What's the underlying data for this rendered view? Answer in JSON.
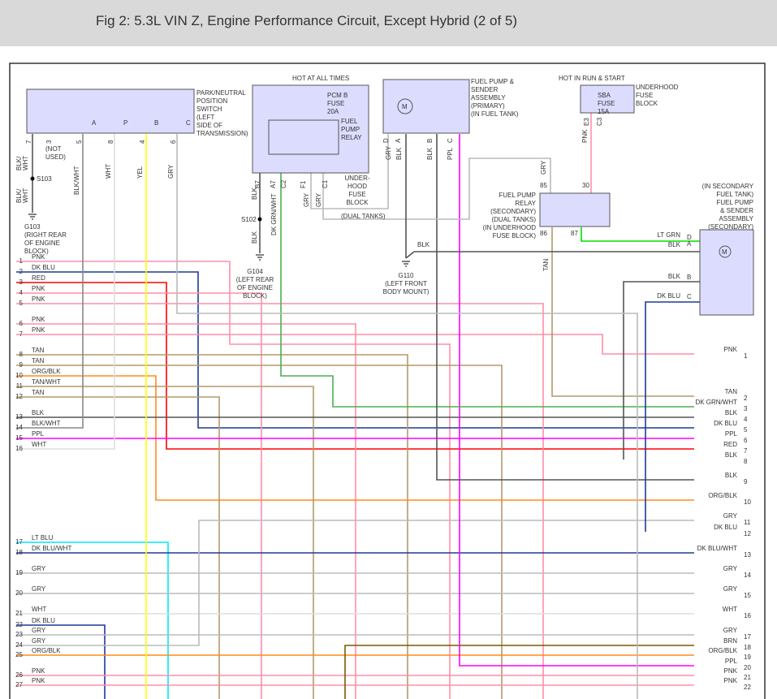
{
  "title": "Fig 2: 5.3L VIN Z, Engine Performance Circuit, Except Hybrid (2 of 5)",
  "components": {
    "pnp_switch": [
      "PARK/NEUTRAL",
      "POSITION",
      "SWITCH",
      "(LEFT",
      "SIDE OF",
      "TRANSMISSION)"
    ],
    "pnp_contacts": [
      "A",
      "P",
      "B",
      "C"
    ],
    "pnp_pins": [
      "7",
      "3",
      "5",
      "8",
      "4",
      "6"
    ],
    "not_used": [
      "(NOT",
      "USED)"
    ],
    "hot_all_times": "HOT AT ALL TIMES",
    "pcm_fuse": [
      "PCM B",
      "FUSE",
      "20A"
    ],
    "fuel_pump_relay": [
      "FUEL",
      "PUMP",
      "RELAY"
    ],
    "underhood_fuse_block_1": [
      "UNDER-",
      "HOOD",
      "FUSE",
      "BLOCK"
    ],
    "fuse_block_pins": [
      "B7",
      "A7",
      "C2",
      "F1",
      "C1"
    ],
    "fuel_pump_primary": [
      "FUEL PUMP &",
      "SENDER",
      "ASSEMBLY",
      "(PRIMARY)",
      "(IN FUEL TANK)"
    ],
    "pump_pins": [
      "D",
      "A",
      "B",
      "C"
    ],
    "hot_run_start": "HOT IN RUN & START",
    "sba_fuse": [
      "SBA",
      "FUSE",
      "15A"
    ],
    "underhood_fuse_block_2": [
      "UNDERHOOD",
      "FUSE",
      "BLOCK"
    ],
    "sba_pins": [
      "E3",
      "C3"
    ],
    "relay_secondary": [
      "FUEL PUMP",
      "RELAY",
      "(SECONDARY)",
      "(DUAL TANKS)",
      "(IN UNDERHOOD",
      "FUSE BLOCK)"
    ],
    "relay_pins": [
      "85",
      "30",
      "86",
      "87"
    ],
    "pump_secondary": [
      "(IN SECONDARY",
      "FUEL TANK)",
      "FUEL PUMP",
      "& SENDER",
      "ASSEMBLY",
      "(SECONDARY)"
    ],
    "secondary_pins": [
      "D",
      "A",
      "B",
      "C"
    ],
    "motor": "M",
    "dual_tanks": "(DUAL TANKS)",
    "splices": [
      "S103",
      "S102"
    ],
    "g103": [
      "G103",
      "(RIGHT REAR",
      "OF ENGINE",
      "BLOCK)"
    ],
    "g104": [
      "G104",
      "(LEFT REAR",
      "OF ENGINE",
      "BLOCK)"
    ],
    "g110": [
      "G110",
      "(LEFT FRONT",
      "BODY MOUNT)"
    ]
  },
  "wire_labels": {
    "pnp": [
      "BLK/",
      "WHT",
      "BLK/",
      "WHT",
      "BLK/WHT",
      "WHT",
      "YEL",
      "GRY"
    ],
    "fuse": [
      "BLK",
      "DK GRN/WHT",
      "GRY",
      "GRY",
      "BLK"
    ],
    "pump": [
      "GRY",
      "BLK",
      "BLK",
      "PPL"
    ],
    "sba": "PNK",
    "relay_gry": "GRY",
    "relay_tan": "TAN",
    "g110_blk": "BLK",
    "secondary": [
      "LT GRN",
      "BLK",
      "BLK",
      "DK BLU"
    ]
  },
  "left_connector": [
    {
      "pin": "1",
      "label": "PNK"
    },
    {
      "pin": "2",
      "label": "DK BLU"
    },
    {
      "pin": "3",
      "label": "RED"
    },
    {
      "pin": "4",
      "label": "PNK"
    },
    {
      "pin": "5",
      "label": "PNK"
    },
    {
      "pin": "6",
      "label": "PNK"
    },
    {
      "pin": "7",
      "label": "PNK"
    },
    {
      "pin": "8",
      "label": "TAN"
    },
    {
      "pin": "9",
      "label": "TAN"
    },
    {
      "pin": "10",
      "label": "ORG/BLK"
    },
    {
      "pin": "11",
      "label": "TAN/WHT"
    },
    {
      "pin": "12",
      "label": "TAN"
    },
    {
      "pin": "13",
      "label": "BLK"
    },
    {
      "pin": "14",
      "label": "BLK/WHT"
    },
    {
      "pin": "15",
      "label": "PPL"
    },
    {
      "pin": "16",
      "label": "WHT"
    },
    {
      "pin": "17",
      "label": "LT BLU"
    },
    {
      "pin": "18",
      "label": "DK BLU/WHT"
    },
    {
      "pin": "19",
      "label": "GRY"
    },
    {
      "pin": "20",
      "label": "GRY"
    },
    {
      "pin": "21",
      "label": "WHT"
    },
    {
      "pin": "22",
      "label": "DK BLU"
    },
    {
      "pin": "23",
      "label": "GRY"
    },
    {
      "pin": "24",
      "label": "GRY"
    },
    {
      "pin": "25",
      "label": "ORG/BLK"
    },
    {
      "pin": "26",
      "label": "PNK"
    },
    {
      "pin": "27",
      "label": "PNK"
    }
  ],
  "right_connector": [
    {
      "pin": "1",
      "label": "PNK"
    },
    {
      "pin": "2",
      "label": "TAN"
    },
    {
      "pin": "3",
      "label": "DK GRN/WHT"
    },
    {
      "pin": "4",
      "label": "BLK"
    },
    {
      "pin": "5",
      "label": "DK BLU"
    },
    {
      "pin": "6",
      "label": "PPL"
    },
    {
      "pin": "7",
      "label": "RED"
    },
    {
      "pin": "8",
      "label": "BLK"
    },
    {
      "pin": "9",
      "label": "BLK"
    },
    {
      "pin": "10",
      "label": "ORG/BLK"
    },
    {
      "pin": "11",
      "label": "GRY"
    },
    {
      "pin": "12",
      "label": "DK BLU"
    },
    {
      "pin": "13",
      "label": "DK BLU/WHT"
    },
    {
      "pin": "14",
      "label": "GRY"
    },
    {
      "pin": "15",
      "label": "GRY"
    },
    {
      "pin": "16",
      "label": "WHT"
    },
    {
      "pin": "17",
      "label": "GRY"
    },
    {
      "pin": "18",
      "label": "BRN"
    },
    {
      "pin": "19",
      "label": "ORG/BLK"
    },
    {
      "pin": "20",
      "label": "PPL"
    },
    {
      "pin": "21",
      "label": "PNK"
    },
    {
      "pin": "22",
      "label": "PNK"
    }
  ],
  "colors": {
    "PNK": "#ff8fa8",
    "DKBLU": "#1f3a93",
    "RED": "#ff0000",
    "TAN": "#b39a6a",
    "ORG": "#ff8c1a",
    "BLK": "#555555",
    "BLKWHT": "#888888",
    "PPL": "#ff00ff",
    "WHT": "#dddddd",
    "GRY": "#bbbbbb",
    "YEL": "#ffff00",
    "LTBLU": "#00e5ff",
    "DKGRN": "#4caf50",
    "LTGRN": "#00e000",
    "BRN": "#7a5a00",
    "box": "#dcdcff"
  }
}
